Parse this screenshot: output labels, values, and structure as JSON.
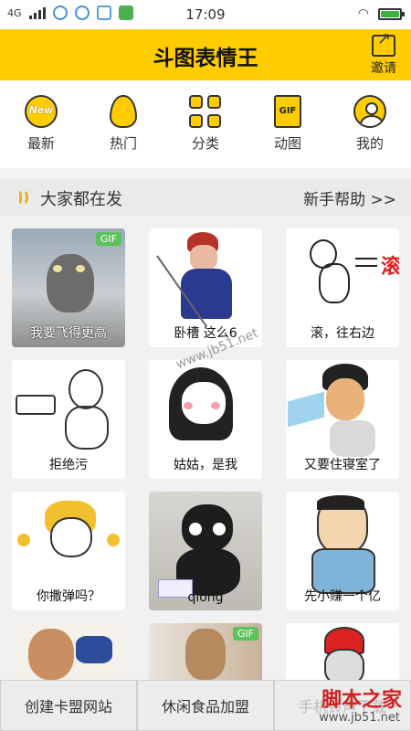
{
  "status_bar": {
    "network": "4G",
    "time": "17:09"
  },
  "header": {
    "title": "斗图表情王",
    "invite_label": "邀请"
  },
  "categories": [
    {
      "label": "最新",
      "icon": "new-badge-icon"
    },
    {
      "label": "热门",
      "icon": "flame-icon"
    },
    {
      "label": "分类",
      "icon": "grid-icon"
    },
    {
      "label": "动图",
      "icon": "gif-file-icon"
    },
    {
      "label": "我的",
      "icon": "user-icon"
    }
  ],
  "section": {
    "title": "大家都在发",
    "help_link": "新手帮助 >>"
  },
  "stickers": [
    {
      "caption": "我要飞得更高",
      "gif": "GIF"
    },
    {
      "caption": "卧槽 这么6",
      "gif": ""
    },
    {
      "caption": "滚，往右边",
      "gif": ""
    },
    {
      "caption": "拒绝污",
      "gif": ""
    },
    {
      "caption": "姑姑，是我",
      "gif": ""
    },
    {
      "caption": "又要住寝室了",
      "gif": ""
    },
    {
      "caption": "你撒弹吗？",
      "gif": ""
    },
    {
      "caption": "qiong",
      "gif": ""
    },
    {
      "caption": "先小赚一个亿",
      "gif": ""
    },
    {
      "caption": "",
      "gif": ""
    },
    {
      "caption": "",
      "gif": "GIF"
    },
    {
      "caption": "",
      "gif": ""
    }
  ],
  "watermarks": {
    "center": "www.jb51.net",
    "corner_title": "脚本之家",
    "corner_url": "www.jb51.net"
  },
  "bottom_bar": {
    "buttons": [
      "创建卡盟网站",
      "休闲食品加盟",
      "手机铃声下载"
    ]
  },
  "colors": {
    "accent": "#ffcc00",
    "gif_badge": "#5cc25c"
  }
}
